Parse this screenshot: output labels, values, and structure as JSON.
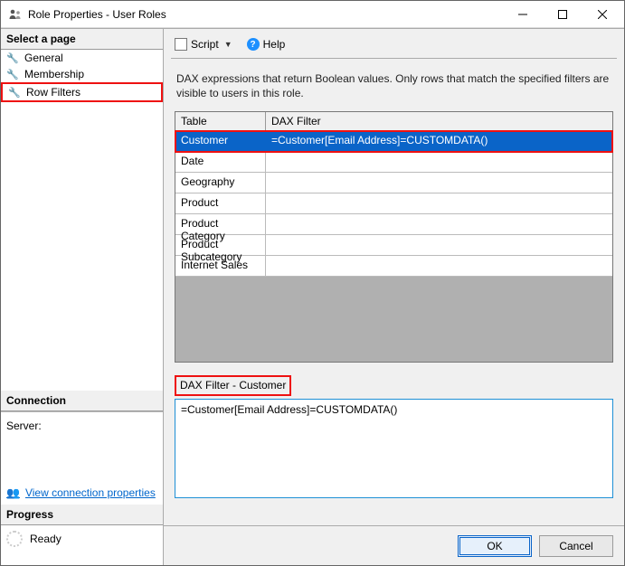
{
  "window": {
    "title": "Role Properties - User Roles"
  },
  "sidebar": {
    "header": "Select a page",
    "items": [
      {
        "label": "General"
      },
      {
        "label": "Membership"
      },
      {
        "label": "Row Filters"
      }
    ],
    "connection_header": "Connection",
    "server_label": "Server:",
    "server_value": "",
    "link_label": "View connection properties",
    "progress_header": "Progress",
    "progress_status": "Ready"
  },
  "toolbar": {
    "script_label": "Script",
    "help_label": "Help"
  },
  "description_text": "DAX expressions that return Boolean values. Only rows that match the specified filters are visible to users in this role.",
  "grid": {
    "col1": "Table",
    "col2": "DAX Filter",
    "rows": [
      {
        "table": "Customer",
        "dax": "=Customer[Email Address]=CUSTOMDATA()"
      },
      {
        "table": "Date",
        "dax": ""
      },
      {
        "table": "Geography",
        "dax": ""
      },
      {
        "table": "Product",
        "dax": ""
      },
      {
        "table": "Product Category",
        "dax": ""
      },
      {
        "table": "Product Subcategory",
        "dax": ""
      },
      {
        "table": "Internet Sales",
        "dax": ""
      }
    ]
  },
  "editor": {
    "label": "DAX Filter - Customer",
    "value": "=Customer[Email Address]=CUSTOMDATA()"
  },
  "buttons": {
    "ok": "OK",
    "cancel": "Cancel"
  }
}
